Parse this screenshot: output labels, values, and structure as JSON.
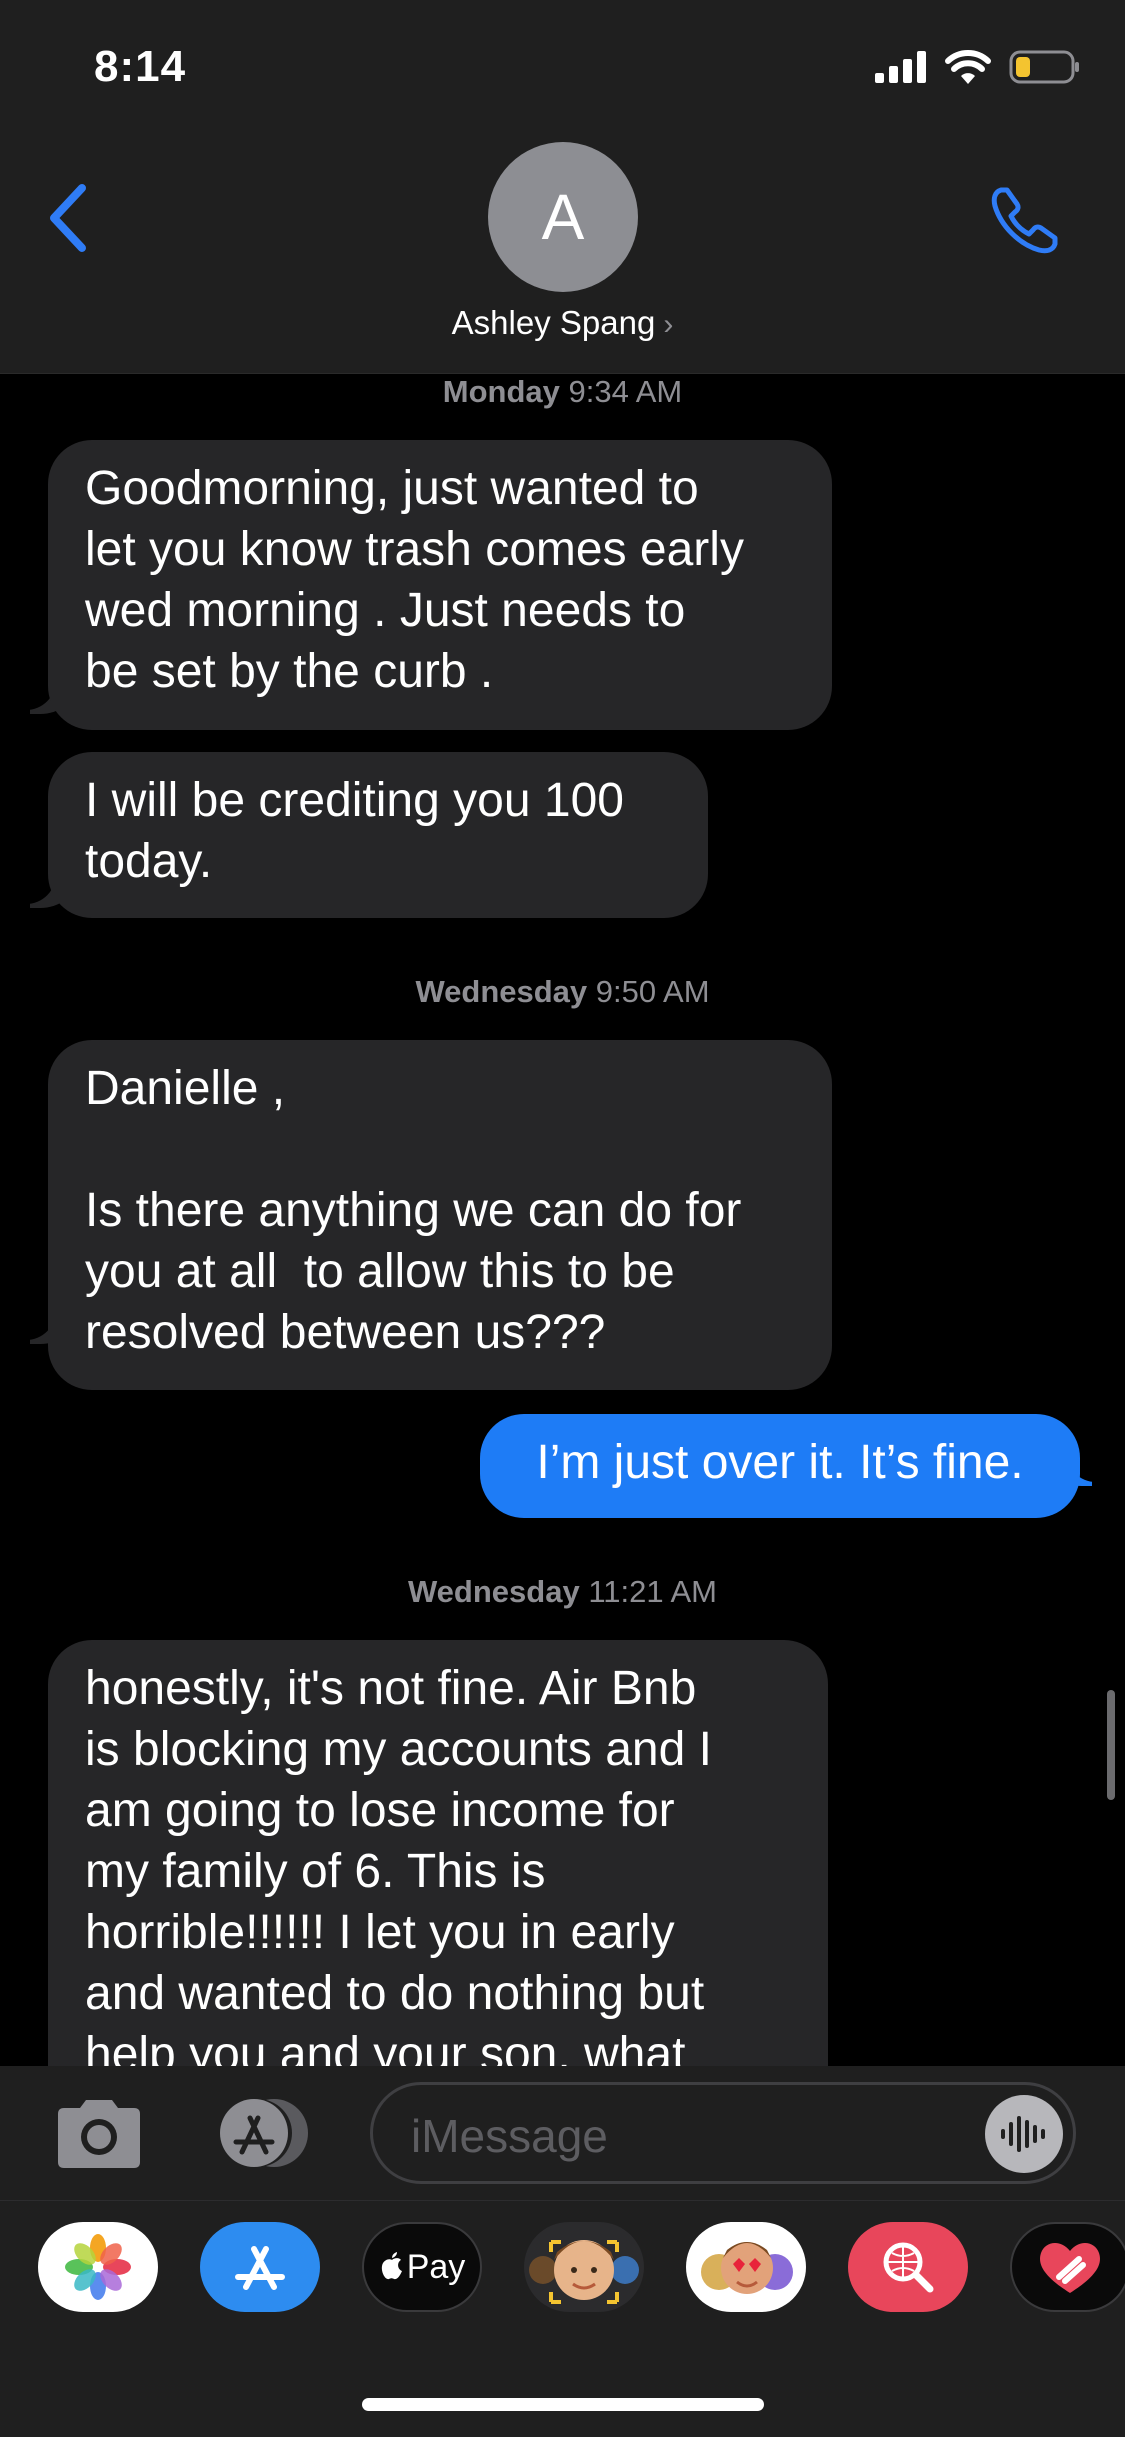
{
  "status_bar": {
    "time": "8:14"
  },
  "header": {
    "avatar_initial": "A",
    "contact_name": "Ashley Spang",
    "contact_chevron": "›",
    "back_icon": "chevron-left-icon",
    "call_icon": "phone-icon"
  },
  "conversation": {
    "timestamps": [
      {
        "day": "Monday",
        "time": "9:34 AM"
      },
      {
        "day": "Wednesday",
        "time": "9:50 AM"
      },
      {
        "day": "Wednesday",
        "time": "11:21 AM"
      }
    ],
    "messages": [
      {
        "direction": "incoming",
        "text": "Goodmorning, just wanted to\nlet you know trash comes early\nwed morning . Just needs to\nbe set by the curb ."
      },
      {
        "direction": "incoming",
        "text": "I will be crediting you 100\ntoday."
      },
      {
        "direction": "incoming",
        "text": "Danielle ,\n\nIs there anything we can do for\nyou at all  to allow this to be\nresolved between us???"
      },
      {
        "direction": "outgoing",
        "text": "I’m just over it. It’s fine."
      },
      {
        "direction": "incoming",
        "text": "honestly, it's not fine. Air Bnb\nis blocking my accounts and I\nam going to lose income for\nmy family of 6. This is\nhorrible!!!!!! I let you in early\nand wanted to do nothing but\nhelp you and your son, what"
      }
    ]
  },
  "input_bar": {
    "placeholder": "iMessage",
    "camera_icon": "camera-icon",
    "apps_icon": "app-store-icon",
    "audio_icon": "audio-waveform-icon"
  },
  "app_drawer": {
    "apps": [
      {
        "name": "Photos",
        "icon": "photos-icon"
      },
      {
        "name": "App Store",
        "icon": "app-store-icon"
      },
      {
        "name": "Pay",
        "label": "Pay",
        "icon": "apple-pay-icon"
      },
      {
        "name": "Memoji",
        "icon": "memoji-icon"
      },
      {
        "name": "Memoji Stickers",
        "icon": "memoji-stickers-icon"
      },
      {
        "name": "Search Images",
        "icon": "image-search-icon"
      },
      {
        "name": "Digital Touch",
        "icon": "digital-touch-heart-icon"
      }
    ]
  },
  "colors": {
    "outgoing_bubble": "#1e7cf6",
    "incoming_bubble": "#262628",
    "accent": "#2f7cf6"
  }
}
